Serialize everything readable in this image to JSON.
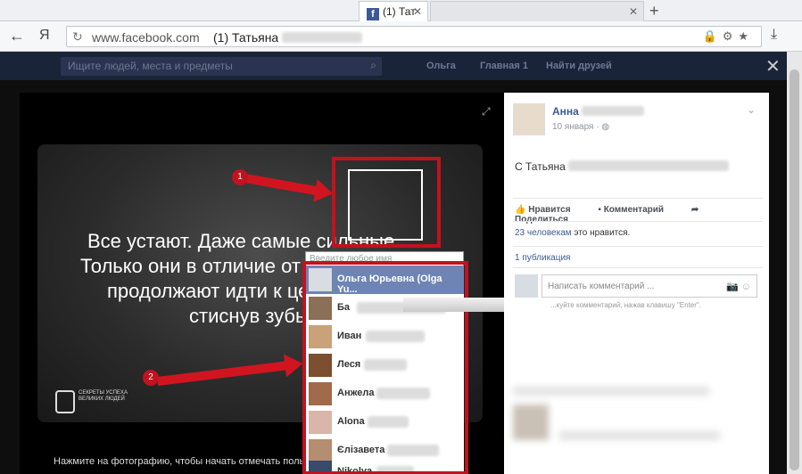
{
  "browser": {
    "tabs": [
      {
        "label": "(1) Тат",
        "icon": "facebook-icon",
        "active": true
      },
      {
        "label": "",
        "active": false
      }
    ],
    "new_tab_symbol": "+",
    "yandex_label": "Я",
    "url": "www.facebook.com",
    "page_title": "(1) Татьяна"
  },
  "fb_header": {
    "search_placeholder": "Ищите людей, места и предметы",
    "nav_user": "Ольга",
    "nav_home": "Главная",
    "nav_home_count": "1",
    "nav_friends": "Найти друзей"
  },
  "photo": {
    "quote_lines": [
      "Все устают. Даже самые сильные.",
      "Только они в отличие от других",
      "продолжают идти к цели,",
      "стиснув зубы."
    ],
    "logo_text": "СЕКРЕТЫ УСПЕХА\nВЕЛИКИХ ЛЮДЕЙ",
    "hint": "Нажмите на фотографию, чтобы начать отмечать пользователей."
  },
  "tagging": {
    "input_placeholder": "Введите любое имя",
    "suggestions": [
      {
        "name": "Ольга Юрьевна (Olga Yu...",
        "selected": true
      },
      {
        "name": "Ба",
        "selected": false
      },
      {
        "name": "Иван",
        "selected": false
      },
      {
        "name": "Леся",
        "selected": false
      },
      {
        "name": "Анжела",
        "selected": false
      },
      {
        "name": "Alona",
        "selected": false
      },
      {
        "name": "Єлізавета",
        "selected": false
      },
      {
        "name": "Nikolya",
        "selected": false
      }
    ]
  },
  "annotations": {
    "badge1": "1",
    "badge2": "2",
    "color": "#c1121f"
  },
  "post": {
    "author": "Анна",
    "date": "10 января",
    "text": "С Татьяна",
    "actions": {
      "like": "Нравится",
      "comment": "Комментарий",
      "share": "Поделиться"
    },
    "likes_link": "23 человекам",
    "likes_rest": " это нравится.",
    "shares": "1 публикация",
    "comment_placeholder": "Написать комментарий ...",
    "comment_hint": "...куйте комментарий, нажав клавишу \"Enter\"."
  },
  "colors": {
    "fb_blue": "#3b5998",
    "selected_row": "#6d84b4",
    "annotation_red": "#c1121f"
  }
}
